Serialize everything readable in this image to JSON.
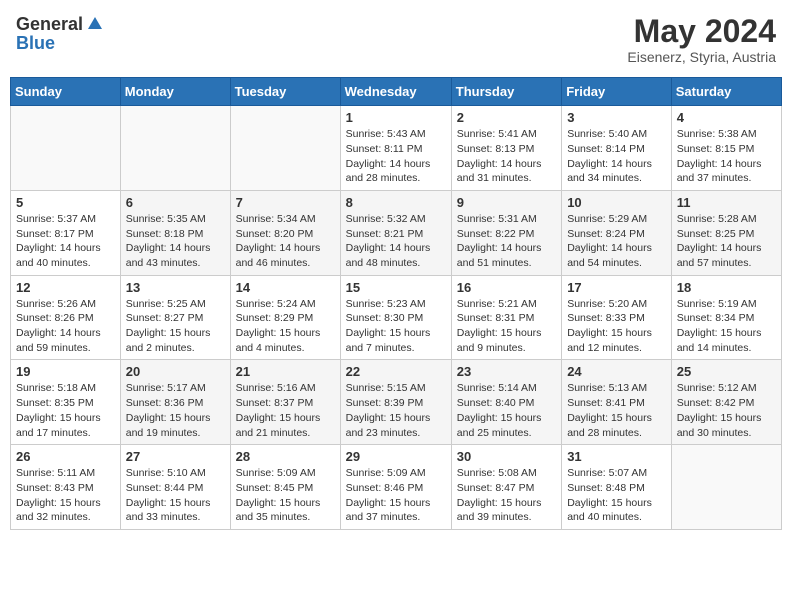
{
  "header": {
    "logo_general": "General",
    "logo_blue": "Blue",
    "month_title": "May 2024",
    "location": "Eisenerz, Styria, Austria"
  },
  "weekdays": [
    "Sunday",
    "Monday",
    "Tuesday",
    "Wednesday",
    "Thursday",
    "Friday",
    "Saturday"
  ],
  "weeks": [
    [
      {
        "day": "",
        "sunrise": "",
        "sunset": "",
        "daylight": ""
      },
      {
        "day": "",
        "sunrise": "",
        "sunset": "",
        "daylight": ""
      },
      {
        "day": "",
        "sunrise": "",
        "sunset": "",
        "daylight": ""
      },
      {
        "day": "1",
        "sunrise": "Sunrise: 5:43 AM",
        "sunset": "Sunset: 8:11 PM",
        "daylight": "Daylight: 14 hours and 28 minutes."
      },
      {
        "day": "2",
        "sunrise": "Sunrise: 5:41 AM",
        "sunset": "Sunset: 8:13 PM",
        "daylight": "Daylight: 14 hours and 31 minutes."
      },
      {
        "day": "3",
        "sunrise": "Sunrise: 5:40 AM",
        "sunset": "Sunset: 8:14 PM",
        "daylight": "Daylight: 14 hours and 34 minutes."
      },
      {
        "day": "4",
        "sunrise": "Sunrise: 5:38 AM",
        "sunset": "Sunset: 8:15 PM",
        "daylight": "Daylight: 14 hours and 37 minutes."
      }
    ],
    [
      {
        "day": "5",
        "sunrise": "Sunrise: 5:37 AM",
        "sunset": "Sunset: 8:17 PM",
        "daylight": "Daylight: 14 hours and 40 minutes."
      },
      {
        "day": "6",
        "sunrise": "Sunrise: 5:35 AM",
        "sunset": "Sunset: 8:18 PM",
        "daylight": "Daylight: 14 hours and 43 minutes."
      },
      {
        "day": "7",
        "sunrise": "Sunrise: 5:34 AM",
        "sunset": "Sunset: 8:20 PM",
        "daylight": "Daylight: 14 hours and 46 minutes."
      },
      {
        "day": "8",
        "sunrise": "Sunrise: 5:32 AM",
        "sunset": "Sunset: 8:21 PM",
        "daylight": "Daylight: 14 hours and 48 minutes."
      },
      {
        "day": "9",
        "sunrise": "Sunrise: 5:31 AM",
        "sunset": "Sunset: 8:22 PM",
        "daylight": "Daylight: 14 hours and 51 minutes."
      },
      {
        "day": "10",
        "sunrise": "Sunrise: 5:29 AM",
        "sunset": "Sunset: 8:24 PM",
        "daylight": "Daylight: 14 hours and 54 minutes."
      },
      {
        "day": "11",
        "sunrise": "Sunrise: 5:28 AM",
        "sunset": "Sunset: 8:25 PM",
        "daylight": "Daylight: 14 hours and 57 minutes."
      }
    ],
    [
      {
        "day": "12",
        "sunrise": "Sunrise: 5:26 AM",
        "sunset": "Sunset: 8:26 PM",
        "daylight": "Daylight: 14 hours and 59 minutes."
      },
      {
        "day": "13",
        "sunrise": "Sunrise: 5:25 AM",
        "sunset": "Sunset: 8:27 PM",
        "daylight": "Daylight: 15 hours and 2 minutes."
      },
      {
        "day": "14",
        "sunrise": "Sunrise: 5:24 AM",
        "sunset": "Sunset: 8:29 PM",
        "daylight": "Daylight: 15 hours and 4 minutes."
      },
      {
        "day": "15",
        "sunrise": "Sunrise: 5:23 AM",
        "sunset": "Sunset: 8:30 PM",
        "daylight": "Daylight: 15 hours and 7 minutes."
      },
      {
        "day": "16",
        "sunrise": "Sunrise: 5:21 AM",
        "sunset": "Sunset: 8:31 PM",
        "daylight": "Daylight: 15 hours and 9 minutes."
      },
      {
        "day": "17",
        "sunrise": "Sunrise: 5:20 AM",
        "sunset": "Sunset: 8:33 PM",
        "daylight": "Daylight: 15 hours and 12 minutes."
      },
      {
        "day": "18",
        "sunrise": "Sunrise: 5:19 AM",
        "sunset": "Sunset: 8:34 PM",
        "daylight": "Daylight: 15 hours and 14 minutes."
      }
    ],
    [
      {
        "day": "19",
        "sunrise": "Sunrise: 5:18 AM",
        "sunset": "Sunset: 8:35 PM",
        "daylight": "Daylight: 15 hours and 17 minutes."
      },
      {
        "day": "20",
        "sunrise": "Sunrise: 5:17 AM",
        "sunset": "Sunset: 8:36 PM",
        "daylight": "Daylight: 15 hours and 19 minutes."
      },
      {
        "day": "21",
        "sunrise": "Sunrise: 5:16 AM",
        "sunset": "Sunset: 8:37 PM",
        "daylight": "Daylight: 15 hours and 21 minutes."
      },
      {
        "day": "22",
        "sunrise": "Sunrise: 5:15 AM",
        "sunset": "Sunset: 8:39 PM",
        "daylight": "Daylight: 15 hours and 23 minutes."
      },
      {
        "day": "23",
        "sunrise": "Sunrise: 5:14 AM",
        "sunset": "Sunset: 8:40 PM",
        "daylight": "Daylight: 15 hours and 25 minutes."
      },
      {
        "day": "24",
        "sunrise": "Sunrise: 5:13 AM",
        "sunset": "Sunset: 8:41 PM",
        "daylight": "Daylight: 15 hours and 28 minutes."
      },
      {
        "day": "25",
        "sunrise": "Sunrise: 5:12 AM",
        "sunset": "Sunset: 8:42 PM",
        "daylight": "Daylight: 15 hours and 30 minutes."
      }
    ],
    [
      {
        "day": "26",
        "sunrise": "Sunrise: 5:11 AM",
        "sunset": "Sunset: 8:43 PM",
        "daylight": "Daylight: 15 hours and 32 minutes."
      },
      {
        "day": "27",
        "sunrise": "Sunrise: 5:10 AM",
        "sunset": "Sunset: 8:44 PM",
        "daylight": "Daylight: 15 hours and 33 minutes."
      },
      {
        "day": "28",
        "sunrise": "Sunrise: 5:09 AM",
        "sunset": "Sunset: 8:45 PM",
        "daylight": "Daylight: 15 hours and 35 minutes."
      },
      {
        "day": "29",
        "sunrise": "Sunrise: 5:09 AM",
        "sunset": "Sunset: 8:46 PM",
        "daylight": "Daylight: 15 hours and 37 minutes."
      },
      {
        "day": "30",
        "sunrise": "Sunrise: 5:08 AM",
        "sunset": "Sunset: 8:47 PM",
        "daylight": "Daylight: 15 hours and 39 minutes."
      },
      {
        "day": "31",
        "sunrise": "Sunrise: 5:07 AM",
        "sunset": "Sunset: 8:48 PM",
        "daylight": "Daylight: 15 hours and 40 minutes."
      },
      {
        "day": "",
        "sunrise": "",
        "sunset": "",
        "daylight": ""
      }
    ]
  ]
}
